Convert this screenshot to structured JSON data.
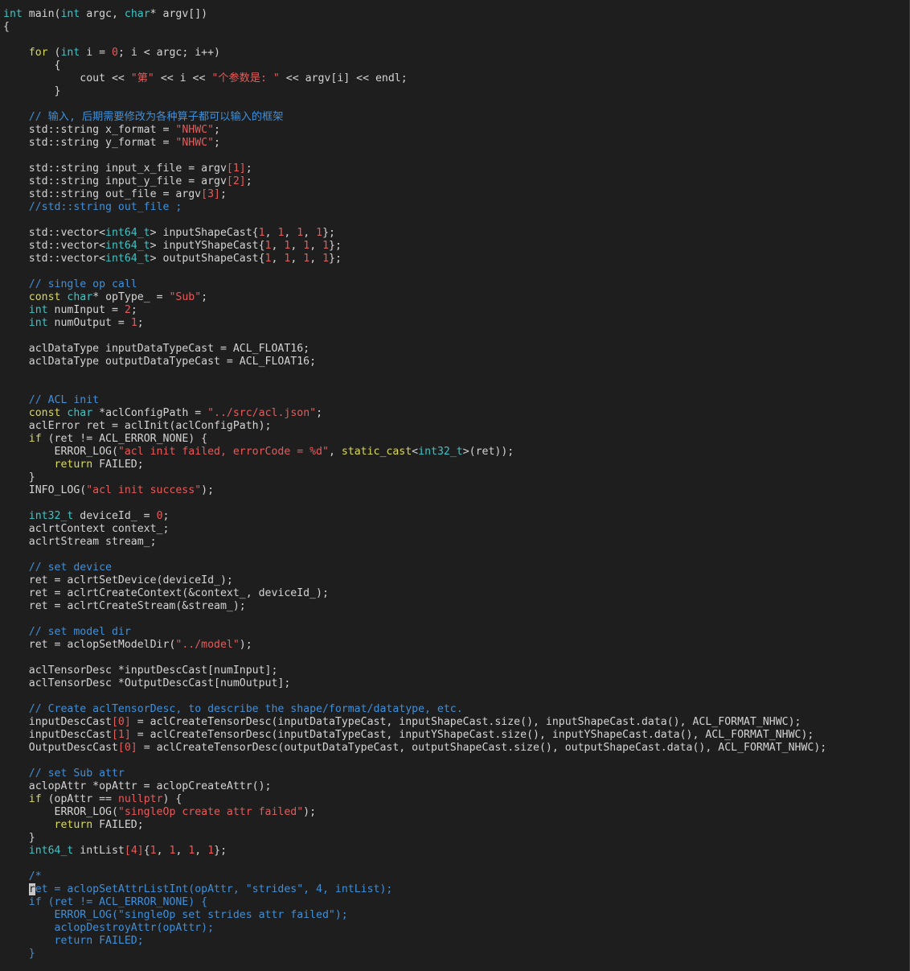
{
  "lines": [
    [
      {
        "t": "int",
        "c": "ty"
      },
      {
        "t": " main("
      },
      {
        "t": "int",
        "c": "ty"
      },
      {
        "t": " argc, "
      },
      {
        "t": "char",
        "c": "ty"
      },
      {
        "t": "* argv[])"
      }
    ],
    [
      {
        "t": "{"
      }
    ],
    [],
    [
      {
        "t": "    "
      },
      {
        "t": "for",
        "c": "kw"
      },
      {
        "t": " ("
      },
      {
        "t": "int",
        "c": "ty"
      },
      {
        "t": " i = "
      },
      {
        "t": "0",
        "c": "num"
      },
      {
        "t": "; i < argc; i++)"
      }
    ],
    [
      {
        "t": "        {"
      }
    ],
    [
      {
        "t": "            cout << "
      },
      {
        "t": "\"第\"",
        "c": "str"
      },
      {
        "t": " << i << "
      },
      {
        "t": "\"个参数是: \"",
        "c": "str"
      },
      {
        "t": " << argv[i] << endl;"
      }
    ],
    [
      {
        "t": "        }"
      }
    ],
    [],
    [
      {
        "t": "    "
      },
      {
        "t": "// 输入, 后期需要修改为各种算子都可以输入的框架",
        "c": "cm"
      }
    ],
    [
      {
        "t": "    std::string x_format = "
      },
      {
        "t": "\"NHWC\"",
        "c": "str"
      },
      {
        "t": ";"
      }
    ],
    [
      {
        "t": "    std::string y_format = "
      },
      {
        "t": "\"NHWC\"",
        "c": "str"
      },
      {
        "t": ";"
      }
    ],
    [],
    [
      {
        "t": "    std::string input_x_file = argv"
      },
      {
        "t": "[1]",
        "c": "br"
      },
      {
        "t": ";"
      }
    ],
    [
      {
        "t": "    std::string input_y_file = argv"
      },
      {
        "t": "[2]",
        "c": "br"
      },
      {
        "t": ";"
      }
    ],
    [
      {
        "t": "    std::string out_file = argv"
      },
      {
        "t": "[3]",
        "c": "br"
      },
      {
        "t": ";"
      }
    ],
    [
      {
        "t": "    "
      },
      {
        "t": "//std::string out_file ;",
        "c": "cm"
      }
    ],
    [],
    [
      {
        "t": "    std::vector<"
      },
      {
        "t": "int64_t",
        "c": "ty"
      },
      {
        "t": "> inputShapeCast{"
      },
      {
        "t": "1",
        "c": "num"
      },
      {
        "t": ", "
      },
      {
        "t": "1",
        "c": "num"
      },
      {
        "t": ", "
      },
      {
        "t": "1",
        "c": "num"
      },
      {
        "t": ", "
      },
      {
        "t": "1",
        "c": "num"
      },
      {
        "t": "};"
      }
    ],
    [
      {
        "t": "    std::vector<"
      },
      {
        "t": "int64_t",
        "c": "ty"
      },
      {
        "t": "> inputYShapeCast{"
      },
      {
        "t": "1",
        "c": "num"
      },
      {
        "t": ", "
      },
      {
        "t": "1",
        "c": "num"
      },
      {
        "t": ", "
      },
      {
        "t": "1",
        "c": "num"
      },
      {
        "t": ", "
      },
      {
        "t": "1",
        "c": "num"
      },
      {
        "t": "};"
      }
    ],
    [
      {
        "t": "    std::vector<"
      },
      {
        "t": "int64_t",
        "c": "ty"
      },
      {
        "t": "> outputShapeCast{"
      },
      {
        "t": "1",
        "c": "num"
      },
      {
        "t": ", "
      },
      {
        "t": "1",
        "c": "num"
      },
      {
        "t": ", "
      },
      {
        "t": "1",
        "c": "num"
      },
      {
        "t": ", "
      },
      {
        "t": "1",
        "c": "num"
      },
      {
        "t": "};"
      }
    ],
    [],
    [
      {
        "t": "    "
      },
      {
        "t": "// single op call",
        "c": "cm"
      }
    ],
    [
      {
        "t": "    "
      },
      {
        "t": "const",
        "c": "kw"
      },
      {
        "t": " "
      },
      {
        "t": "char",
        "c": "ty"
      },
      {
        "t": "* opType_ = "
      },
      {
        "t": "\"Sub\"",
        "c": "str"
      },
      {
        "t": ";"
      }
    ],
    [
      {
        "t": "    "
      },
      {
        "t": "int",
        "c": "ty"
      },
      {
        "t": " numInput = "
      },
      {
        "t": "2",
        "c": "num"
      },
      {
        "t": ";"
      }
    ],
    [
      {
        "t": "    "
      },
      {
        "t": "int",
        "c": "ty"
      },
      {
        "t": " numOutput = "
      },
      {
        "t": "1",
        "c": "num"
      },
      {
        "t": ";"
      }
    ],
    [],
    [
      {
        "t": "    aclDataType inputDataTypeCast = ACL_FLOAT16;"
      }
    ],
    [
      {
        "t": "    aclDataType outputDataTypeCast = ACL_FLOAT16;"
      }
    ],
    [],
    [],
    [
      {
        "t": "    "
      },
      {
        "t": "// ACL init",
        "c": "cm"
      }
    ],
    [
      {
        "t": "    "
      },
      {
        "t": "const",
        "c": "kw"
      },
      {
        "t": " "
      },
      {
        "t": "char",
        "c": "ty"
      },
      {
        "t": " *aclConfigPath = "
      },
      {
        "t": "\"../src/acl.json\"",
        "c": "str"
      },
      {
        "t": ";"
      }
    ],
    [
      {
        "t": "    aclError ret = aclInit(aclConfigPath);"
      }
    ],
    [
      {
        "t": "    "
      },
      {
        "t": "if",
        "c": "kw"
      },
      {
        "t": " (ret != ACL_ERROR_NONE) {"
      }
    ],
    [
      {
        "t": "        ERROR_LOG("
      },
      {
        "t": "\"acl init failed, errorCode = %d\"",
        "c": "str"
      },
      {
        "t": ", "
      },
      {
        "t": "static_cast",
        "c": "kw"
      },
      {
        "t": "<"
      },
      {
        "t": "int32_t",
        "c": "ty"
      },
      {
        "t": ">(ret));"
      }
    ],
    [
      {
        "t": "        "
      },
      {
        "t": "return",
        "c": "kw"
      },
      {
        "t": " FAILED;"
      }
    ],
    [
      {
        "t": "    }"
      }
    ],
    [
      {
        "t": "    INFO_LOG("
      },
      {
        "t": "\"acl init success\"",
        "c": "str"
      },
      {
        "t": ");"
      }
    ],
    [],
    [
      {
        "t": "    "
      },
      {
        "t": "int32_t",
        "c": "ty"
      },
      {
        "t": " deviceId_ = "
      },
      {
        "t": "0",
        "c": "num"
      },
      {
        "t": ";"
      }
    ],
    [
      {
        "t": "    aclrtContext context_;"
      }
    ],
    [
      {
        "t": "    aclrtStream stream_;"
      }
    ],
    [],
    [
      {
        "t": "    "
      },
      {
        "t": "// set device",
        "c": "cm"
      }
    ],
    [
      {
        "t": "    ret = aclrtSetDevice(deviceId_);"
      }
    ],
    [
      {
        "t": "    ret = aclrtCreateContext(&context_, deviceId_);"
      }
    ],
    [
      {
        "t": "    ret = aclrtCreateStream(&stream_);"
      }
    ],
    [],
    [
      {
        "t": "    "
      },
      {
        "t": "// set model dir",
        "c": "cm"
      }
    ],
    [
      {
        "t": "    ret = aclopSetModelDir("
      },
      {
        "t": "\"../model\"",
        "c": "str"
      },
      {
        "t": ");"
      }
    ],
    [],
    [
      {
        "t": "    aclTensorDesc *inputDescCast[numInput];"
      }
    ],
    [
      {
        "t": "    aclTensorDesc *OutputDescCast[numOutput];"
      }
    ],
    [],
    [
      {
        "t": "    "
      },
      {
        "t": "// Create aclTensorDesc, to describe the shape/format/datatype, etc.",
        "c": "cm"
      }
    ],
    [
      {
        "t": "    inputDescCast"
      },
      {
        "t": "[0]",
        "c": "br"
      },
      {
        "t": " = aclCreateTensorDesc(inputDataTypeCast, inputShapeCast.size(), inputShapeCast.data(), ACL_FORMAT_NHWC);"
      }
    ],
    [
      {
        "t": "    inputDescCast"
      },
      {
        "t": "[1]",
        "c": "br"
      },
      {
        "t": " = aclCreateTensorDesc(inputDataTypeCast, inputYShapeCast.size(), inputYShapeCast.data(), ACL_FORMAT_NHWC);"
      }
    ],
    [
      {
        "t": "    OutputDescCast"
      },
      {
        "t": "[0]",
        "c": "br"
      },
      {
        "t": " = aclCreateTensorDesc(outputDataTypeCast, outputShapeCast.size(), outputShapeCast.data(), ACL_FORMAT_NHWC);"
      }
    ],
    [],
    [
      {
        "t": "    "
      },
      {
        "t": "// set Sub attr",
        "c": "cm"
      }
    ],
    [
      {
        "t": "    aclopAttr *opAttr = aclopCreateAttr();"
      }
    ],
    [
      {
        "t": "    "
      },
      {
        "t": "if",
        "c": "kw"
      },
      {
        "t": " (opAttr == "
      },
      {
        "t": "nullptr",
        "c": "str"
      },
      {
        "t": ") {"
      }
    ],
    [
      {
        "t": "        ERROR_LOG("
      },
      {
        "t": "\"singleOp create attr failed\"",
        "c": "str"
      },
      {
        "t": ");"
      }
    ],
    [
      {
        "t": "        "
      },
      {
        "t": "return",
        "c": "kw"
      },
      {
        "t": " FAILED;"
      }
    ],
    [
      {
        "t": "    }"
      }
    ],
    [
      {
        "t": "    "
      },
      {
        "t": "int64_t",
        "c": "ty"
      },
      {
        "t": " intList"
      },
      {
        "t": "[4]",
        "c": "br"
      },
      {
        "t": "{"
      },
      {
        "t": "1",
        "c": "num"
      },
      {
        "t": ", "
      },
      {
        "t": "1",
        "c": "num"
      },
      {
        "t": ", "
      },
      {
        "t": "1",
        "c": "num"
      },
      {
        "t": ", "
      },
      {
        "t": "1",
        "c": "num"
      },
      {
        "t": "};"
      }
    ],
    [],
    [
      {
        "t": "    "
      },
      {
        "t": "/*",
        "c": "cm"
      }
    ],
    [
      {
        "t": "    "
      },
      {
        "t": "r",
        "c": "cursor"
      },
      {
        "t": "et = aclopSetAttrListInt(opAttr, \"strides\", 4, intList);",
        "c": "cm"
      }
    ],
    [
      {
        "t": "    if (ret != ACL_ERROR_NONE) {",
        "c": "cm"
      }
    ],
    [
      {
        "t": "        ERROR_LOG(\"singleOp set strides attr failed\");",
        "c": "cm"
      }
    ],
    [
      {
        "t": "        aclopDestroyAttr(opAttr);",
        "c": "cm"
      }
    ],
    [
      {
        "t": "        return FAILED;",
        "c": "cm"
      }
    ],
    [
      {
        "t": "    }",
        "c": "cm"
      }
    ]
  ]
}
